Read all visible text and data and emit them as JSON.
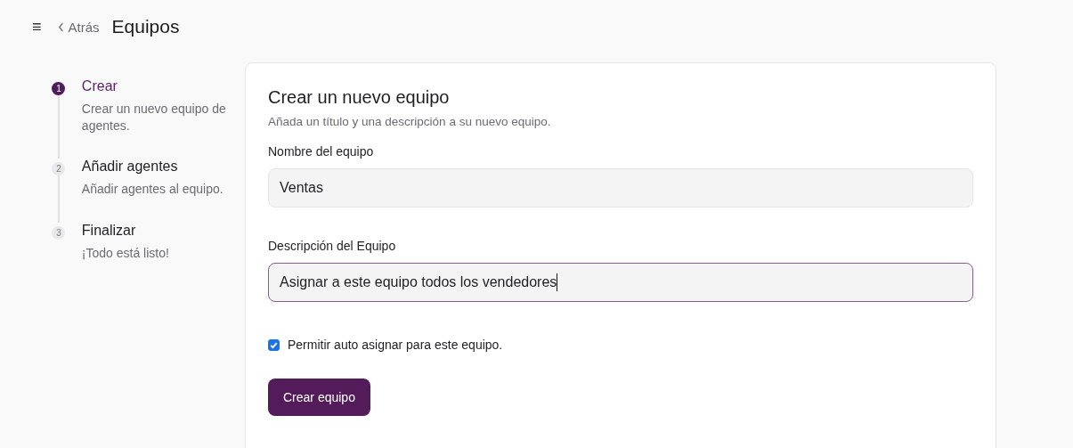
{
  "header": {
    "menu_icon": "≡",
    "back": "Atrás",
    "title": "Equipos"
  },
  "steps": [
    {
      "number": "1",
      "title": "Crear",
      "description": "Crear un nuevo equipo de agentes.",
      "selected": true
    },
    {
      "number": "2",
      "title": "Añadir agentes",
      "description": "Añadir agentes al equipo.",
      "selected": false
    },
    {
      "number": "3",
      "title": "Finalizar",
      "description": "¡Todo está listo!",
      "selected": false
    }
  ],
  "form": {
    "title": "Crear un nuevo equipo",
    "subtitle": "Añada un título y una descripción a su nuevo equipo.",
    "fields": [
      {
        "label": "Nombre del equipo",
        "value": "Ventas",
        "focused": false
      },
      {
        "label": "Descripción del Equipo",
        "value": "Asignar a este equipo todos los vendedores",
        "focused": true
      }
    ],
    "checkbox": {
      "label": "Permitir auto asignar para este equipo.",
      "checked": true
    },
    "submit": "Crear equipo"
  }
}
